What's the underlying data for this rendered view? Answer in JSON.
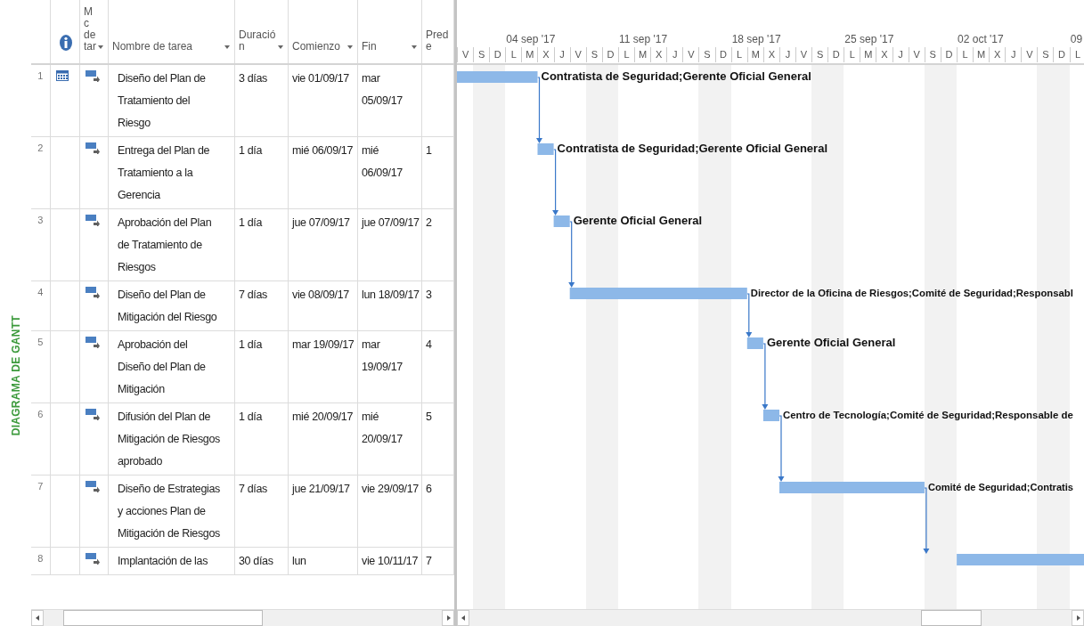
{
  "side_label": "DIAGRAMA DE GANTT",
  "columns": [
    {
      "kind": "row_number"
    },
    {
      "kind": "info_icon"
    },
    {
      "kind": "text",
      "label": "Mc de tar",
      "filter": true
    },
    {
      "kind": "text",
      "label": "Nombre de tarea",
      "filter": true
    },
    {
      "kind": "text",
      "label": "Duración",
      "filter": true
    },
    {
      "kind": "text",
      "label": "Comienzo",
      "filter": true
    },
    {
      "kind": "text",
      "label": "Fin",
      "filter": true
    },
    {
      "kind": "text",
      "label": "Prede",
      "filter": false
    }
  ],
  "timeline": {
    "lead_days": [
      {
        "letter": "V",
        "weekend": false
      },
      {
        "letter": "S",
        "weekend": true
      },
      {
        "letter": "D",
        "weekend": true
      }
    ],
    "weeks": [
      {
        "label": "04 sep '17",
        "days": [
          {
            "letter": "L",
            "weekend": false
          },
          {
            "letter": "M",
            "weekend": false
          },
          {
            "letter": "X",
            "weekend": false
          },
          {
            "letter": "J",
            "weekend": false
          },
          {
            "letter": "V",
            "weekend": false
          },
          {
            "letter": "S",
            "weekend": true
          },
          {
            "letter": "D",
            "weekend": true
          }
        ]
      },
      {
        "label": "11 sep '17",
        "days": [
          {
            "letter": "L",
            "weekend": false
          },
          {
            "letter": "M",
            "weekend": false
          },
          {
            "letter": "X",
            "weekend": false
          },
          {
            "letter": "J",
            "weekend": false
          },
          {
            "letter": "V",
            "weekend": false
          },
          {
            "letter": "S",
            "weekend": true
          },
          {
            "letter": "D",
            "weekend": true
          }
        ]
      },
      {
        "label": "18 sep '17",
        "days": [
          {
            "letter": "L",
            "weekend": false
          },
          {
            "letter": "M",
            "weekend": false
          },
          {
            "letter": "X",
            "weekend": false
          },
          {
            "letter": "J",
            "weekend": false
          },
          {
            "letter": "V",
            "weekend": false
          },
          {
            "letter": "S",
            "weekend": true
          },
          {
            "letter": "D",
            "weekend": true
          }
        ]
      },
      {
        "label": "25 sep '17",
        "days": [
          {
            "letter": "L",
            "weekend": false
          },
          {
            "letter": "M",
            "weekend": false
          },
          {
            "letter": "X",
            "weekend": false
          },
          {
            "letter": "J",
            "weekend": false
          },
          {
            "letter": "V",
            "weekend": false
          },
          {
            "letter": "S",
            "weekend": true
          },
          {
            "letter": "D",
            "weekend": true
          }
        ]
      },
      {
        "label": "02 oct '17",
        "days": [
          {
            "letter": "L",
            "weekend": false
          },
          {
            "letter": "M",
            "weekend": false
          },
          {
            "letter": "X",
            "weekend": false
          },
          {
            "letter": "J",
            "weekend": false
          },
          {
            "letter": "V",
            "weekend": false
          },
          {
            "letter": "S",
            "weekend": true
          },
          {
            "letter": "D",
            "weekend": true
          }
        ]
      },
      {
        "label": "09",
        "days": [
          {
            "letter": "L",
            "weekend": false
          }
        ]
      }
    ]
  },
  "tasks": [
    {
      "id": "1",
      "calendar_indicator": true,
      "name": "Diseño del Plan de Tratamiento del Riesgo",
      "duration": "3 días",
      "start": "vie 01/09/17",
      "end": "mar 05/09/17",
      "resources": "Contratista de Seguridad;Gerente Oficial General"
    },
    {
      "id": "2",
      "calendar_indicator": false,
      "name": "Entrega del Plan de Tratamiento a la Gerencia",
      "duration": "1 día",
      "start": "mié 06/09/17",
      "end": "mié 06/09/17",
      "predecessors": "1",
      "resources": "Contratista de Seguridad;Gerente Oficial General"
    },
    {
      "id": "3",
      "calendar_indicator": false,
      "name": "Aprobación del Plan de Tratamiento de Riesgos",
      "duration": "1 día",
      "start": "jue 07/09/17",
      "end": "jue 07/09/17",
      "predecessors": "2",
      "resources": "Gerente Oficial General"
    },
    {
      "id": "4",
      "calendar_indicator": false,
      "name": "Diseño del Plan de Mitigación del Riesgo",
      "duration": "7 días",
      "start": "vie 08/09/17",
      "end": "lun 18/09/17",
      "predecessors": "3",
      "resources": "Director de la Oficina de Riesgos;Comité de Seguridad;Responsabl"
    },
    {
      "id": "5",
      "calendar_indicator": false,
      "name": "Aprobación del Diseño del Plan de Mitigación",
      "duration": "1 día",
      "start": "mar 19/09/17",
      "end": "mar 19/09/17",
      "predecessors": "4",
      "resources": "Gerente Oficial General"
    },
    {
      "id": "6",
      "calendar_indicator": false,
      "name": "Difusión del Plan de Mitigación de Riesgos aprobado",
      "duration": "1 día",
      "start": "mié 20/09/17",
      "end": "mié 20/09/17",
      "predecessors": "5",
      "resources": "Centro de Tecnología;Comité de Seguridad;Responsable de"
    },
    {
      "id": "7",
      "calendar_indicator": false,
      "name": "Diseño de Estrategias y acciones Plan de Mitigación de Riesgos",
      "duration": "7 días",
      "start": "jue 21/09/17",
      "end": "vie 29/09/17",
      "predecessors": "6",
      "resources": "Comité de Seguridad;Contratis"
    },
    {
      "id": "8",
      "calendar_indicator": false,
      "name": "Implantación de las",
      "duration": "30 días",
      "start": "lun",
      "end": "vie 10/11/17",
      "predecessors": "7"
    }
  ]
}
